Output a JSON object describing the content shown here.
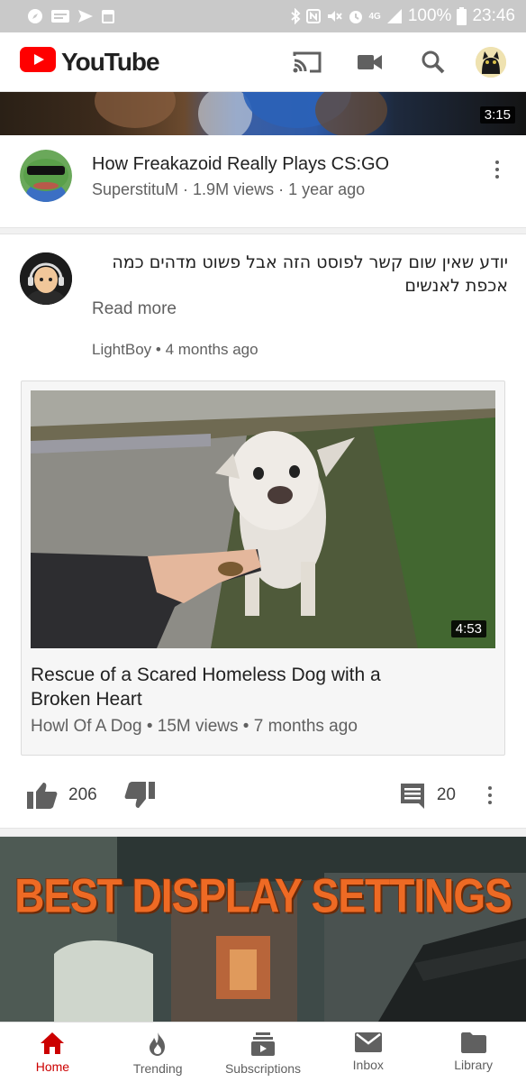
{
  "status_bar": {
    "battery": "100%",
    "time": "23:46",
    "network": "4G"
  },
  "app_bar": {
    "logo_text": "YouTube",
    "brand_color": "#ff0000"
  },
  "top_video": {
    "duration": "3:15"
  },
  "video_item": {
    "title": "How Freakazoid Really Plays CS:GO",
    "channel": "SuperstituM",
    "views": "1.9M views",
    "age": "1 year ago"
  },
  "post": {
    "text": "יודע שאין שום קשר לפוסט הזה אבל פשוט מדהים כמה אכפת לאנשים",
    "read_more": "Read more",
    "author": "LightBoy",
    "age": "4 months ago",
    "shared_video": {
      "duration": "4:53",
      "title": "Rescue of a Scared Homeless Dog with a Broken Heart",
      "channel": "Howl Of A Dog",
      "views": "15M views",
      "age": "7 months ago"
    },
    "likes": "206",
    "comments": "20"
  },
  "banner": {
    "text": "BEST DISPLAY SETTINGS"
  },
  "bottom_nav": [
    {
      "label": "Home",
      "icon": "home-icon",
      "active": true
    },
    {
      "label": "Trending",
      "icon": "flame-icon",
      "active": false
    },
    {
      "label": "Subscriptions",
      "icon": "subscriptions-icon",
      "active": false
    },
    {
      "label": "Inbox",
      "icon": "mail-icon",
      "active": false
    },
    {
      "label": "Library",
      "icon": "folder-icon",
      "active": false
    }
  ]
}
